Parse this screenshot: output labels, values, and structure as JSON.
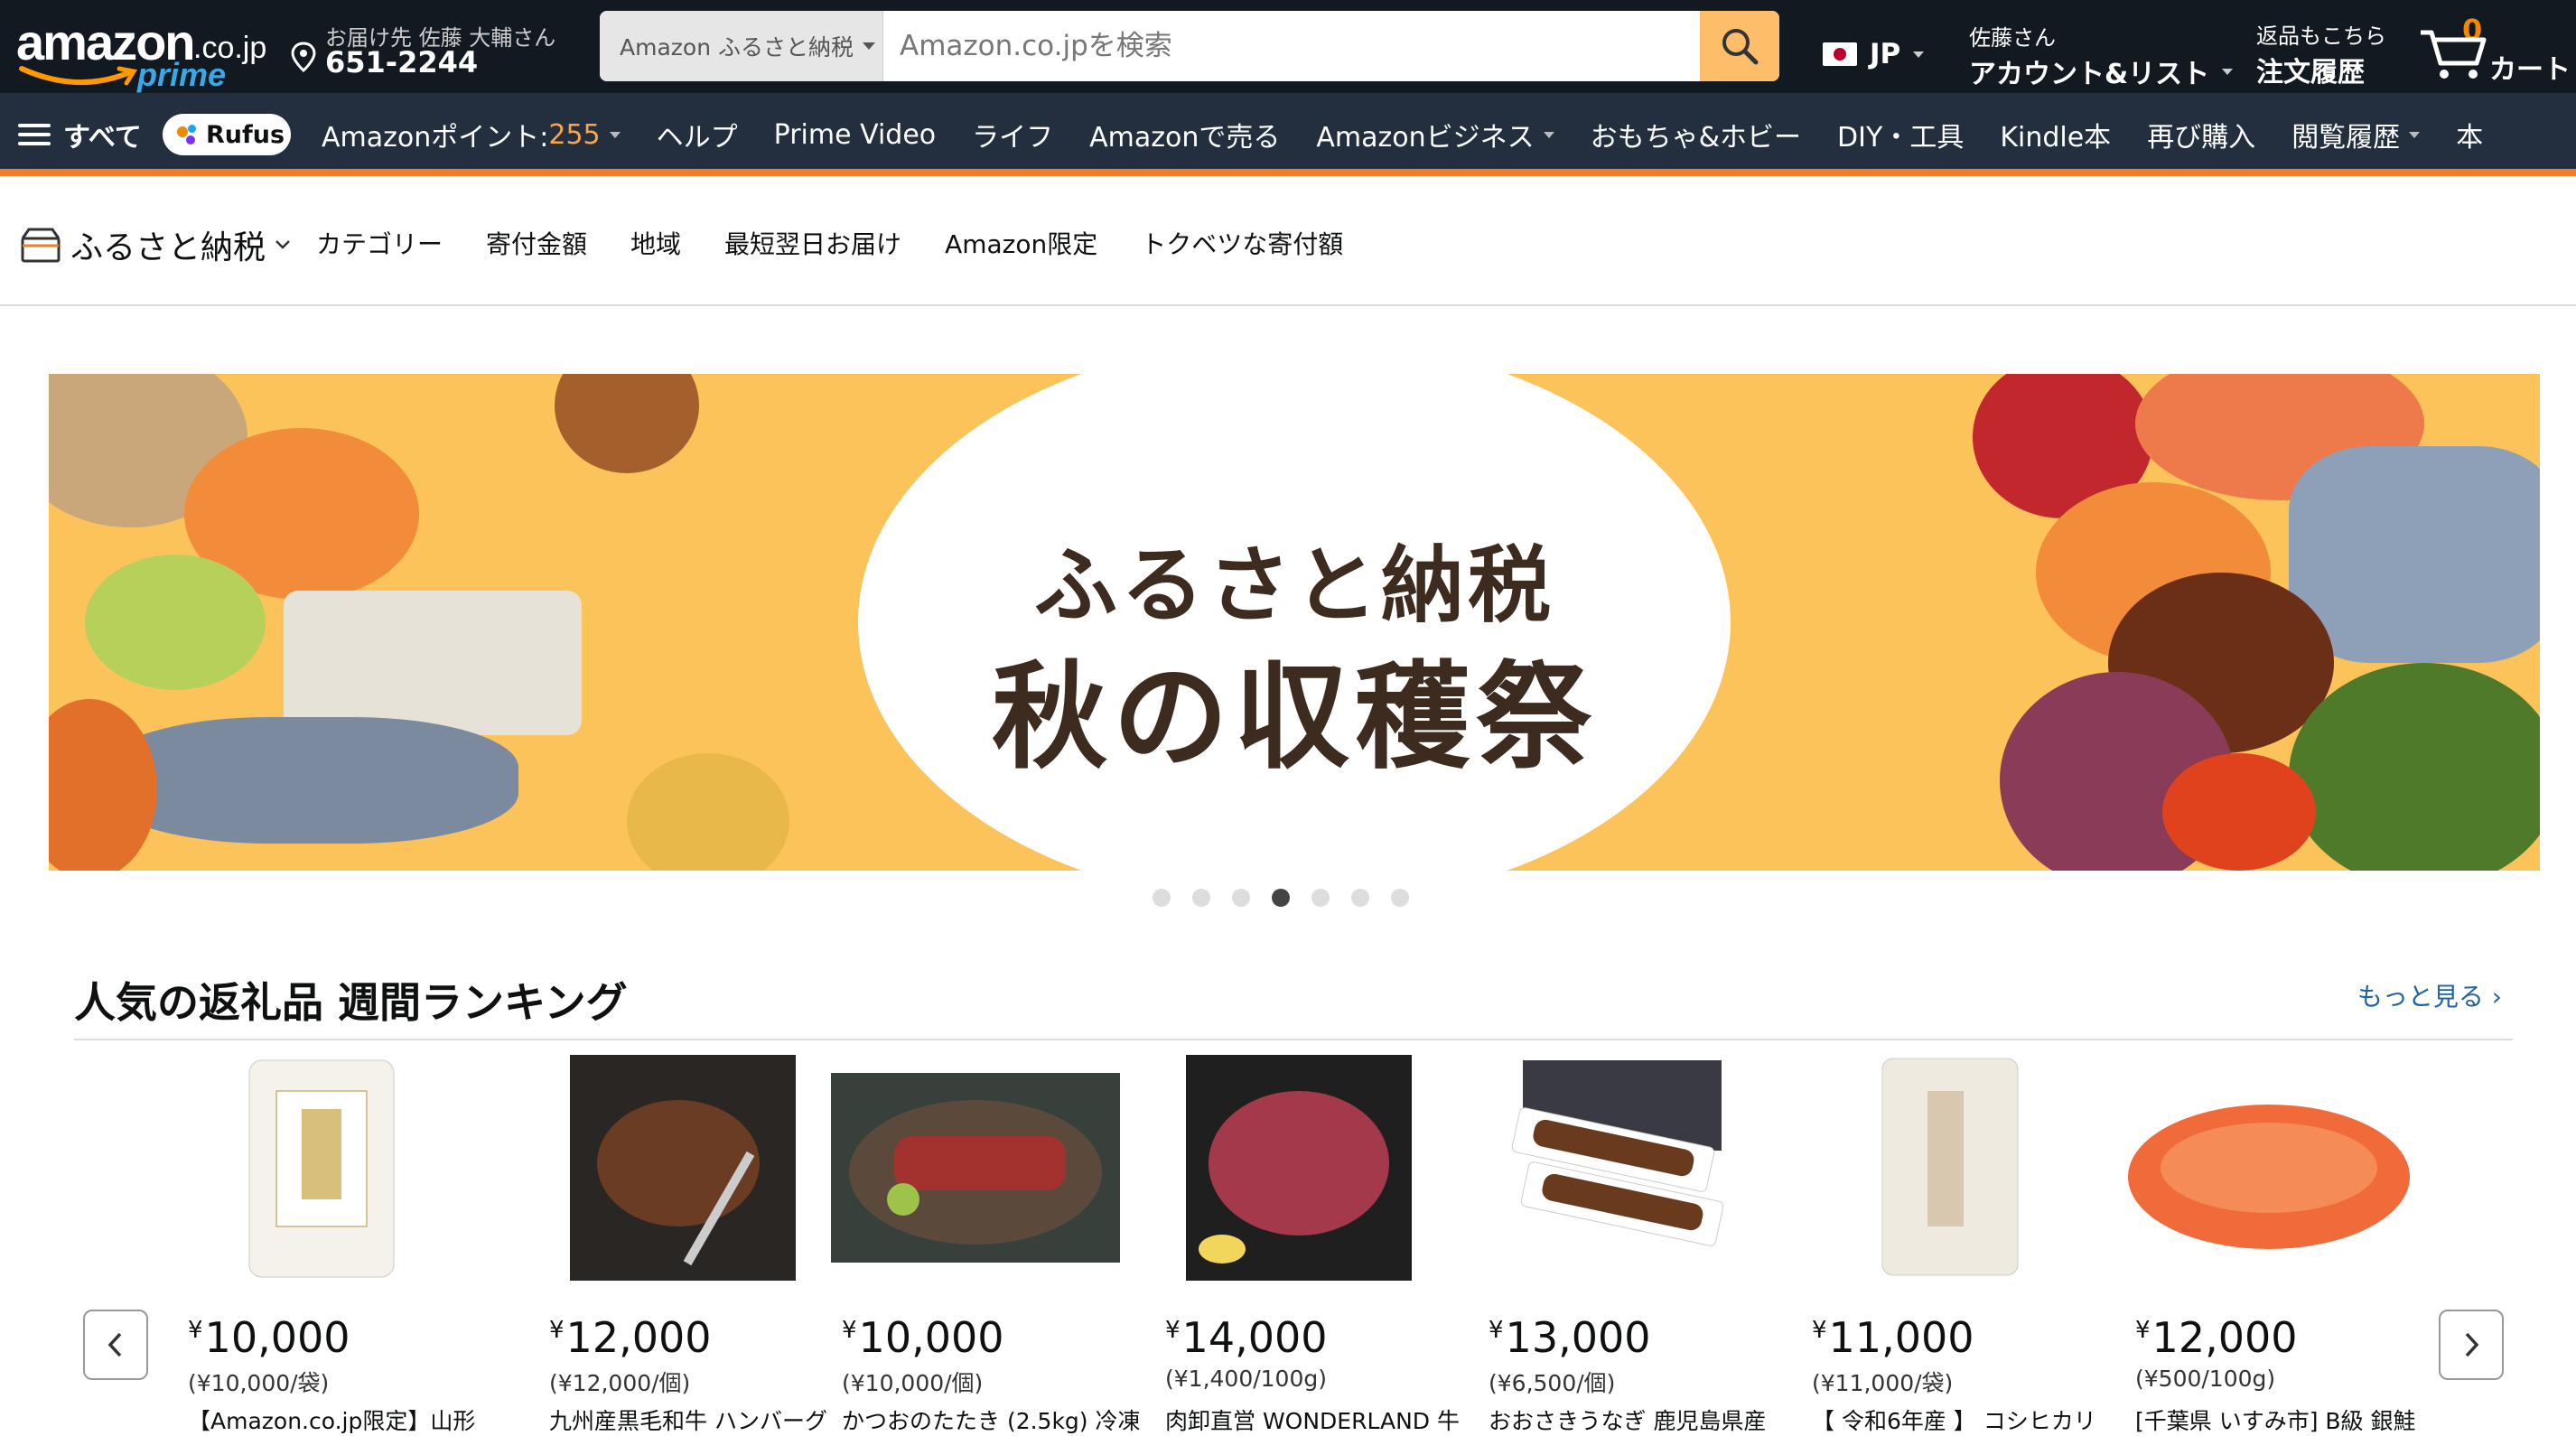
{
  "header": {
    "logo_word": "amazon",
    "logo_domain": ".co.jp",
    "logo_prime": "prime",
    "deliver_to": "お届け先 佐藤 大輔さん",
    "postal_code": "651-2244",
    "search_scope": "Amazon ふるさと納税",
    "search_placeholder": "Amazon.co.jpを検索",
    "language": "JP",
    "account_greeting": "佐藤さん",
    "account_label": "アカウント&リスト",
    "returns_label": "返品もこちら",
    "orders_label": "注文履歴",
    "cart_count": "0",
    "cart_label": "カート"
  },
  "subnav": {
    "all_label": "すべて",
    "rufus_label": "Rufus",
    "points_label": "Amazonポイント: ",
    "points_value": "255",
    "items": [
      "ヘルプ",
      "Prime Video",
      "ライフ",
      "Amazonで売る",
      "Amazonビジネス",
      "おもちゃ&ホビー",
      "DIY・工具",
      "Kindle本",
      "再び購入",
      "閲覧履歴",
      "本"
    ]
  },
  "furusato_nav": {
    "brand": "ふるさと納税",
    "links": [
      "カテゴリー",
      "寄付金額",
      "地域",
      "最短翌日お届け",
      "Amazon限定",
      "トクベツな寄付額"
    ]
  },
  "hero": {
    "title_line1": "ふるさと納税",
    "title_line2": "秋の収穫祭",
    "slide_count": 7,
    "active_slide": 4
  },
  "ranking": {
    "title": "人気の返礼品 週間ランキング",
    "more_link": "もっと見る ›",
    "products": [
      {
        "price": "10,000",
        "unit": "(¥10,000/袋)",
        "name": "【Amazon.co.jp限定】山形"
      },
      {
        "price": "12,000",
        "unit": "(¥12,000/個)",
        "name": "九州産黒毛和牛 ハンバーグ"
      },
      {
        "price": "10,000",
        "unit": "(¥10,000/個)",
        "name": "かつおのたたき (2.5kg) 冷凍"
      },
      {
        "price": "14,000",
        "unit": "(¥1,400/100g)",
        "name": "肉卸直営 WONDERLAND 牛"
      },
      {
        "price": "13,000",
        "unit": "(¥6,500/個)",
        "name": "おおさきうなぎ 鹿児島県産"
      },
      {
        "price": "11,000",
        "unit": "(¥11,000/袋)",
        "name": "【 令和6年産 】 コシヒカリ"
      },
      {
        "price": "12,000",
        "unit": "(¥500/100g)",
        "name": "[千葉県 いすみ市] B級 銀鮭"
      }
    ]
  },
  "colors": {
    "nav_bg": "#131921",
    "subnav_bg": "#232f3e",
    "accent_orange": "#febd69",
    "points_orange": "#f9a64a",
    "link_blue": "#2162a1"
  }
}
